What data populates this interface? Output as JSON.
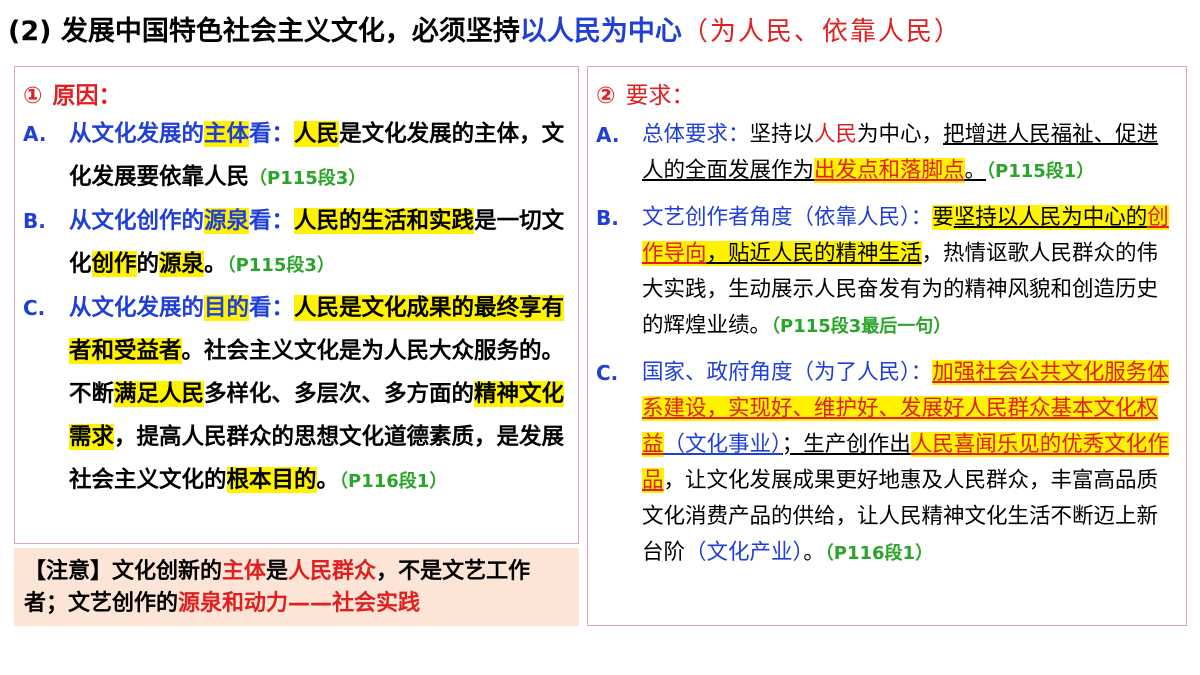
{
  "title": {
    "prefix": "(2) 发展中国特色社会主义文化，必须坚持",
    "highlight": "以人民为中心",
    "subtitle": "（为人民、依靠人民）"
  },
  "left": {
    "num": "①",
    "heading": "原因：",
    "items": [
      {
        "marker": "A.",
        "p1": "从文化发展的",
        "p2": "主体",
        "p3": "看：",
        "p4": "人民",
        "p5": "是文化发展的主体，文化发展要依靠人民",
        "ref": "（P115段3）"
      },
      {
        "marker": "B.",
        "p1": "从文化创作的",
        "p2": "源泉",
        "p3": "看：",
        "p4": "人民的生活和实践",
        "p5": "是一切文化",
        "p6": "创作",
        "p7": "的",
        "p8": "源泉",
        "p9": "。",
        "ref": "（P115段3）"
      },
      {
        "marker": "C.",
        "p1": "从文化发展的",
        "p2": "目的",
        "p3": "看：",
        "p4": "人民是文化成果的最终享有者和受益者",
        "p5": "。社会主义文化是为人民大众服务的。不断",
        "p6": "满足人民",
        "p7": "多样化、多层次、多方面的",
        "p8": "精神文化需求",
        "p9": "，提高人民群众的思想文化道德素质，是发展社会主义文化的",
        "p10": "根本目的",
        "p11": "。",
        "ref": "（P116段1）"
      }
    ]
  },
  "note": {
    "p1": "【注意】文化创新的",
    "p2": "主体",
    "p3": "是",
    "p4": "人民群众",
    "p5": "，不是文艺工作者；文艺创作的",
    "p6": "源泉和动力",
    "p7": "——",
    "p8": "社会实践"
  },
  "right": {
    "num": "②",
    "heading": "要求：",
    "items": [
      {
        "marker": "A.",
        "p1": "总体要求：",
        "p2": "坚持以",
        "p3": "人民",
        "p4": "为中心，",
        "p5": "把增进人民福祉、促进人的全面发展作为",
        "p6": "出发点和落脚点",
        "p7": "。",
        "ref": "（P115段1）"
      },
      {
        "marker": "B.",
        "p1": "文艺创作者角度（依靠人民）：",
        "p2": "要",
        "p3": "坚持以人民为中心的",
        "p4": "创作导向",
        "p5": "，贴近人民的精神生活",
        "p6": "，热情讴歌人民群众的伟大实践，生动展示人民奋发有为的精神风貌和创造历史的辉煌业绩。",
        "ref": "（P115段3最后一句）"
      },
      {
        "marker": "C.",
        "p1": "国家、政府角度（为了人民）：",
        "p2": "加强社会公共文化服务体系建设，实现好、维护好、发展好人民群众基本文化权益",
        "p3": "（文化事业）",
        "p4": "；生产创作出",
        "p5": "人民喜闻乐见的优秀文化作品",
        "p6": "，让文化发展成果更好地惠及人民群众，丰富高品质文化消费产品的供给，让人民精神文化生活不断迈上新台阶",
        "p7": "（文化产业）",
        "p8": "。",
        "ref": "（P116段1）"
      }
    ]
  }
}
